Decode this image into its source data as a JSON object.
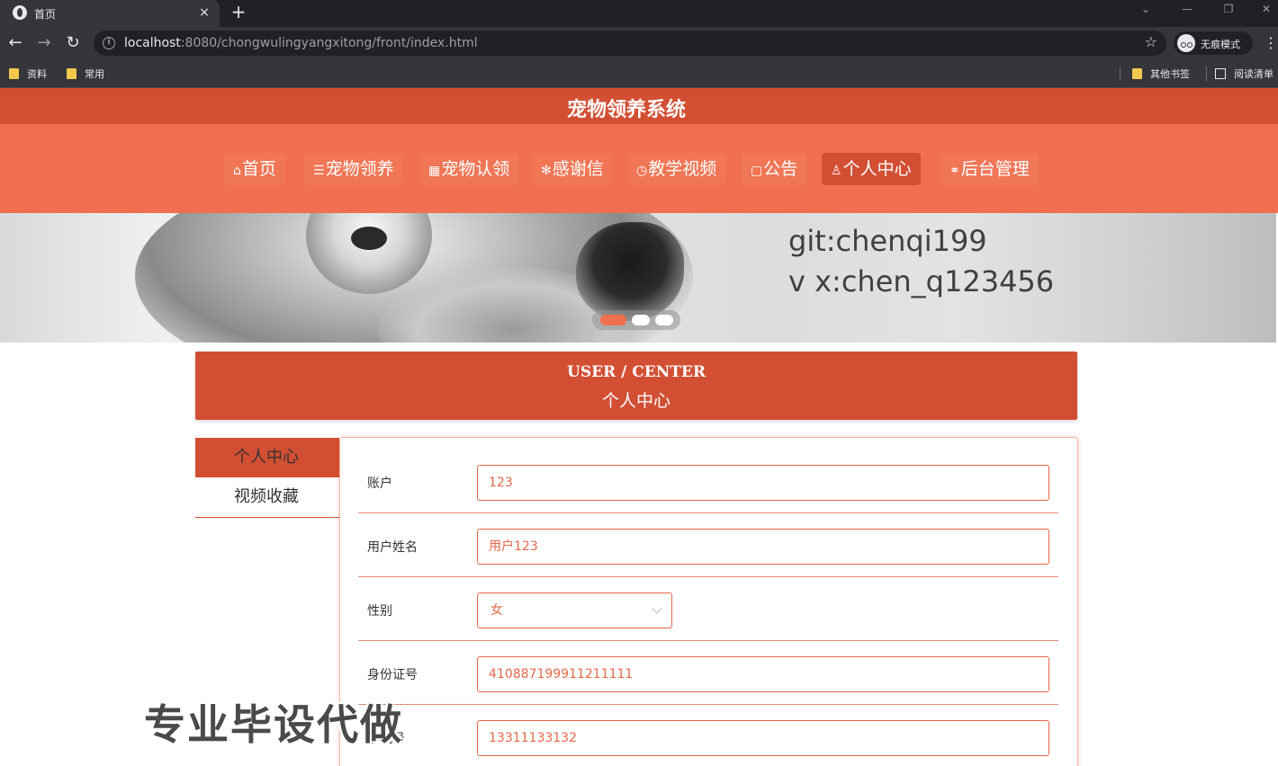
{
  "browser": {
    "tab_title": "首页",
    "tab_close": "×",
    "new_tab": "+",
    "url_host": "localhost",
    "url_rest": ":8080/chongwulingyangxitong/front/index.html",
    "incognito_label": "无痕模式",
    "bookmarks": [
      "资料",
      "常用"
    ],
    "other_bookmarks": "其他书签",
    "reading_list": "阅读清单"
  },
  "site": {
    "title": "宠物领养系统",
    "nav": [
      {
        "icon": "⌂",
        "label": "首页"
      },
      {
        "icon": "☰",
        "label": "宠物领养"
      },
      {
        "icon": "▦",
        "label": "宠物认领"
      },
      {
        "icon": "✻",
        "label": "感谢信"
      },
      {
        "icon": "◷",
        "label": "教学视频"
      },
      {
        "icon": "▢",
        "label": "公告"
      },
      {
        "icon": "♙",
        "label": "个人中心"
      },
      {
        "icon": "⚭",
        "label": "后台管理"
      }
    ],
    "active_nav": "个人中心"
  },
  "banner": {
    "line1": "git:chenqi199",
    "line2": "v x:chen_q123456",
    "slide_count": 3,
    "active_slide": 1
  },
  "user_center": {
    "title_en": "USER / CENTER",
    "title_cn": "个人中心",
    "menu": [
      "个人中心",
      "视频收藏"
    ],
    "active_menu": "个人中心"
  },
  "form": {
    "account_label": "账户",
    "account_value": "123",
    "name_label": "用户姓名",
    "name_value": "用户123",
    "gender_label": "性别",
    "gender_value": "女",
    "id_label": "身份证号",
    "id_value": "410887199911211111",
    "phone_label": "手机号",
    "phone_value": "13311133132"
  },
  "watermark": "专业毕设代做",
  "colors": {
    "title_bar": "#d24f33",
    "nav_bar": "#ef6f4f",
    "accent": "#e5674a"
  }
}
